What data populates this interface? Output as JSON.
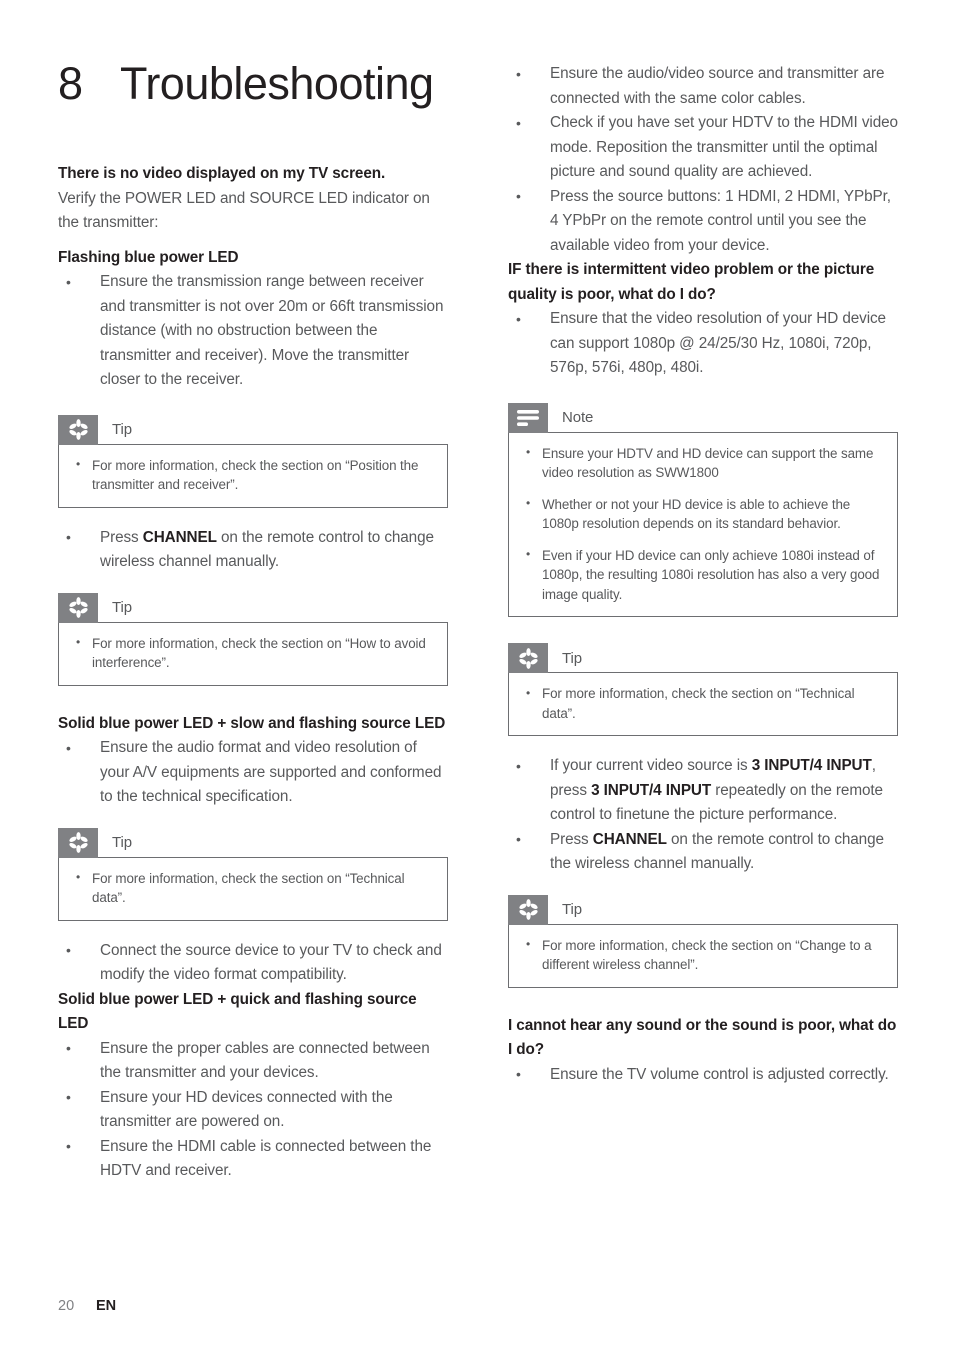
{
  "document": {
    "chapter_number": "8",
    "chapter_title": "Troubleshooting",
    "footer": {
      "page_number": "20",
      "language": "EN"
    },
    "colors": {
      "heading": "#231f20",
      "body": "#58595b",
      "callout_tab": "#808184",
      "callout_border": "#6d6e71",
      "page_background": "#ffffff"
    }
  },
  "left_column": {
    "intro": {
      "heading": "There is no video displayed on my TV screen.",
      "text": "Verify the POWER LED and SOURCE LED indicator on the transmitter:"
    },
    "section_flashing": {
      "heading": "Flashing blue power LED",
      "bullet_1": "Ensure the transmission range between receiver and transmitter is not over 20m or 66ft transmission distance (with no obstruction between the transmitter and receiver). Move the transmitter closer to the receiver."
    },
    "tip_1": {
      "label": "Tip",
      "icon": "asterisk-icon",
      "items": [
        "For more information, check the section on “Position the transmitter and receiver”."
      ]
    },
    "bullet_channel": {
      "prefix": "Press ",
      "bold": "CHANNEL",
      "suffix": " on the remote control to change wireless channel manually."
    },
    "tip_2": {
      "label": "Tip",
      "icon": "asterisk-icon",
      "items": [
        "For more information, check the section on “How to avoid interference”."
      ]
    },
    "section_slow": {
      "heading": "Solid blue power LED + slow and flashing source LED",
      "bullet_1": "Ensure the audio format and video resolution of your A/V equipments are supported and conformed to the technical specification."
    },
    "tip_3": {
      "label": "Tip",
      "icon": "asterisk-icon",
      "items": [
        "For more information, check the section on “Technical data”."
      ]
    },
    "bullet_connect": "Connect the source device to your TV to check and modify the video format compatibility.",
    "section_quick": {
      "heading": "Solid blue power LED + quick and flashing source LED",
      "bullets": [
        "Ensure the proper cables are connected between the transmitter and your devices.",
        "Ensure your HD devices connected with the transmitter are powered on.",
        "Ensure the HDMI cable is connected between the HDTV and receiver."
      ]
    }
  },
  "right_column": {
    "top_bullets": [
      "Ensure the audio/video source and transmitter are connected with the same color cables.",
      "Check if you have set your HDTV to the HDMI video mode. Reposition the transmitter until the optimal picture and sound quality are achieved.",
      "Press the source buttons: 1 HDMI, 2 HDMI, YPbPr, 4 YPbPr on the remote control until you see the available video from your device."
    ],
    "section_intermittent": {
      "heading": "IF there is intermittent video problem or the picture quality is poor, what do I do?",
      "bullet_1": "Ensure that the video resolution of your HD device can support 1080p @ 24/25/30 Hz, 1080i, 720p, 576p, 576i, 480p, 480i."
    },
    "note_1": {
      "label": "Note",
      "icon": "note-lines-icon",
      "items": [
        "Ensure your HDTV and HD device can support the same video resolution as SWW1800",
        "Whether or not your HD device is able to achieve the 1080p resolution depends on its standard behavior.",
        "Even if your HD device can only achieve 1080i instead of 1080p, the resulting 1080i resolution has also a very good image quality."
      ]
    },
    "tip_4": {
      "label": "Tip",
      "icon": "asterisk-icon",
      "items": [
        "For more information, check the section on “Technical data”."
      ]
    },
    "bullet_input": {
      "part_1": "If your current video source is ",
      "bold_1": "3 INPUT/4 INPUT",
      "part_2": ", press ",
      "bold_2": "3 INPUT/4 INPUT",
      "part_3": " repeatedly on the remote control to finetune the picture performance."
    },
    "bullet_channel": {
      "prefix": "Press ",
      "bold": "CHANNEL",
      "suffix": " on the remote control to change the wireless channel manually."
    },
    "tip_5": {
      "label": "Tip",
      "icon": "asterisk-icon",
      "items": [
        "For more information, check the section on “Change to a different wireless channel”."
      ]
    },
    "section_sound": {
      "heading": "I cannot hear any sound or the sound is poor, what do I do?",
      "bullet_1": "Ensure the TV volume control is adjusted correctly."
    }
  }
}
